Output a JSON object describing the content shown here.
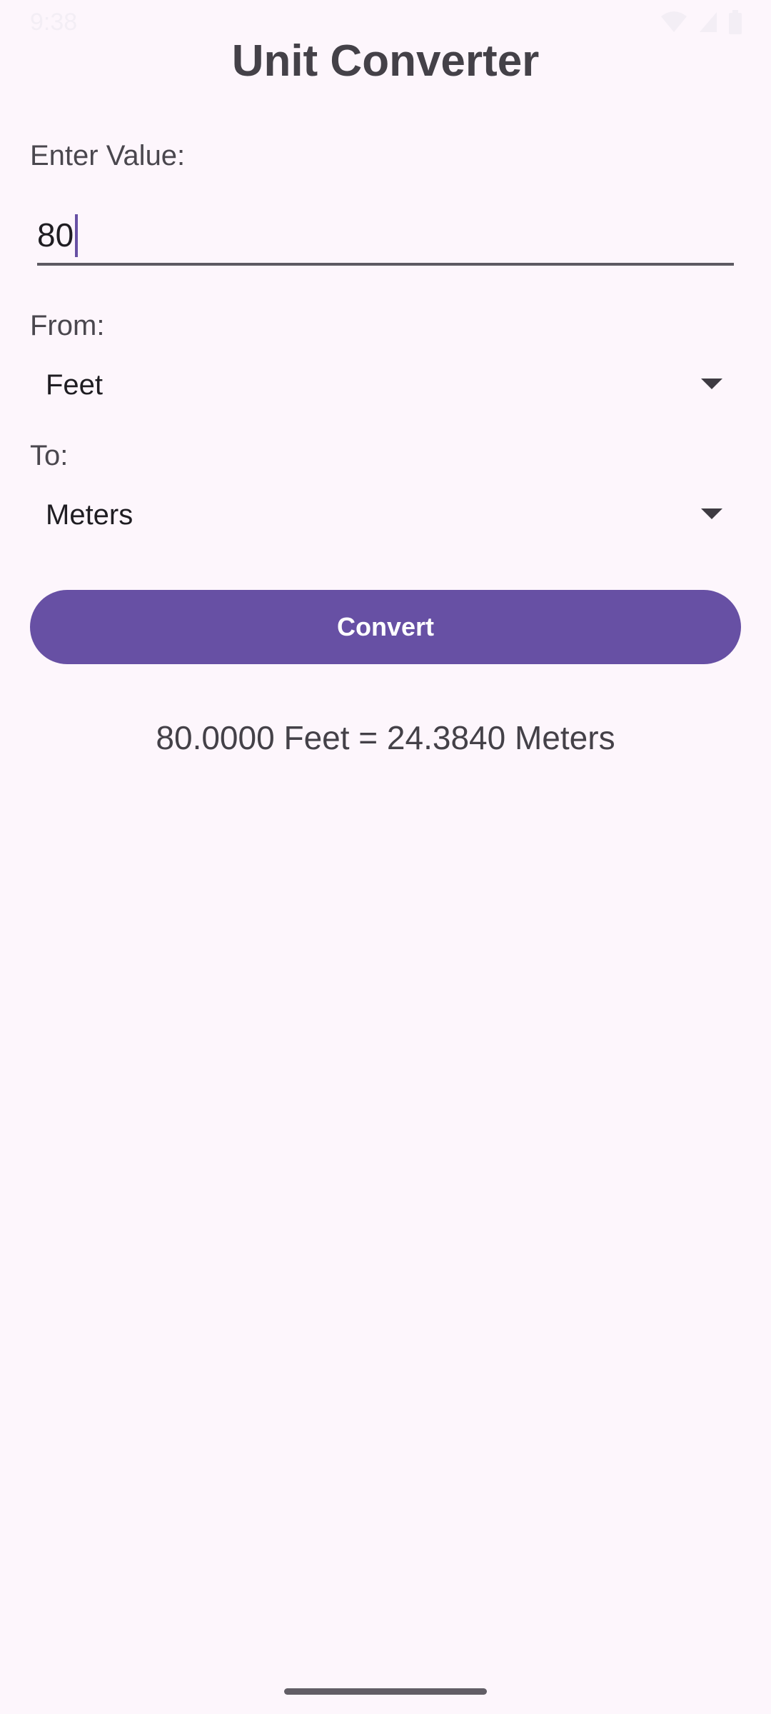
{
  "status_bar": {
    "time": "9:38",
    "icons": [
      "wifi-icon",
      "signal-icon",
      "battery-icon"
    ]
  },
  "app": {
    "title": "Unit Converter"
  },
  "form": {
    "value_label": "Enter Value:",
    "value": "80",
    "from_label": "From:",
    "from_value": "Feet",
    "to_label": "To:",
    "to_value": "Meters",
    "convert_label": "Convert"
  },
  "result": {
    "text": "80.0000 Feet = 24.3840 Meters"
  },
  "colors": {
    "background": "#fdf6fc",
    "accent": "#6750a4",
    "text": "#444148"
  }
}
